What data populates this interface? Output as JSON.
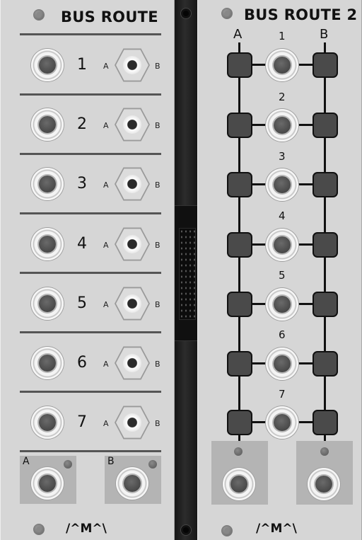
{
  "module1": {
    "title": "BUS ROUTE",
    "rows": [
      {
        "num": "1",
        "a": "A",
        "b": "B"
      },
      {
        "num": "2",
        "a": "A",
        "b": "B"
      },
      {
        "num": "3",
        "a": "A",
        "b": "B"
      },
      {
        "num": "4",
        "a": "A",
        "b": "B"
      },
      {
        "num": "5",
        "a": "A",
        "b": "B"
      },
      {
        "num": "6",
        "a": "A",
        "b": "B"
      },
      {
        "num": "7",
        "a": "A",
        "b": "B"
      }
    ],
    "out_a": "A",
    "out_b": "B",
    "logo": "/^M^\\"
  },
  "module2": {
    "title": "BUS ROUTE 2",
    "col_a": "A",
    "col_1": "1",
    "col_b": "B",
    "row_nums": [
      "2",
      "3",
      "4",
      "5",
      "6",
      "7"
    ],
    "logo": "/^M^\\"
  }
}
